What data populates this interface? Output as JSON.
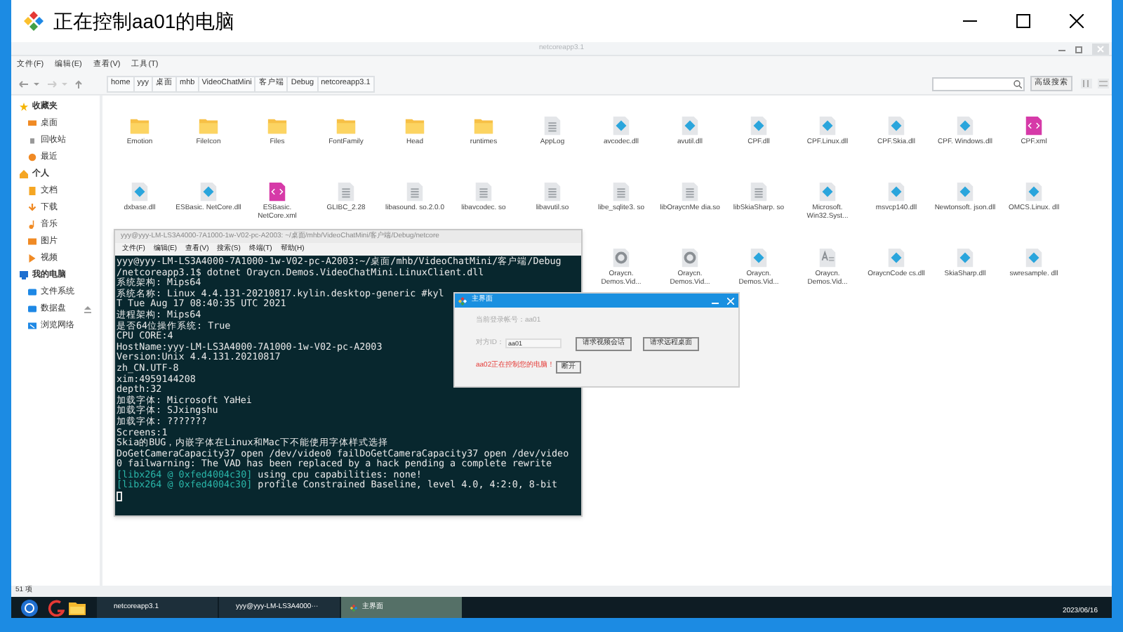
{
  "remote_window": {
    "title": "正在控制aa01的电脑"
  },
  "file_manager": {
    "title": "netcoreapp3.1",
    "menu": [
      "文件(F)",
      "编辑(E)",
      "查看(V)",
      "工具(T)"
    ],
    "breadcrumb": [
      "home",
      "yyy",
      "桌面",
      "mhb",
      "VideoChatMini",
      "客户端",
      "Debug",
      "netcoreapp3.1"
    ],
    "advanced_search_button": "高级搜索",
    "sidebar": [
      {
        "label": "收藏夹",
        "kind": "header"
      },
      {
        "label": "桌面",
        "kind": "item"
      },
      {
        "label": "回收站",
        "kind": "item"
      },
      {
        "label": "最近",
        "kind": "item"
      },
      {
        "label": "个人",
        "kind": "header"
      },
      {
        "label": "文档",
        "kind": "item"
      },
      {
        "label": "下载",
        "kind": "item"
      },
      {
        "label": "音乐",
        "kind": "item"
      },
      {
        "label": "图片",
        "kind": "item"
      },
      {
        "label": "视频",
        "kind": "item"
      },
      {
        "label": "我的电脑",
        "kind": "header"
      },
      {
        "label": "文件系统",
        "kind": "item"
      },
      {
        "label": "数据盘",
        "kind": "item",
        "ejectable": true
      },
      {
        "label": "浏览网络",
        "kind": "item"
      }
    ],
    "file_rows": [
      [
        {
          "name": "Emotion",
          "kind": "folder"
        },
        {
          "name": "FileIcon",
          "kind": "folder"
        },
        {
          "name": "Files",
          "kind": "folder"
        },
        {
          "name": "FontFamily",
          "kind": "folder"
        },
        {
          "name": "Head",
          "kind": "folder"
        },
        {
          "name": "runtimes",
          "kind": "folder"
        },
        {
          "name": "AppLog",
          "kind": "text"
        },
        {
          "name": "avcodec.dll",
          "kind": "dll"
        },
        {
          "name": "avutil.dll",
          "kind": "dll"
        },
        {
          "name": "CPF.dll",
          "kind": "dll"
        },
        {
          "name": "CPF.Linux.dll",
          "kind": "dll"
        },
        {
          "name": "CPF.Skia.dll",
          "kind": "dll"
        },
        {
          "name": "CPF. Windows.dll",
          "kind": "dll"
        },
        {
          "name": "CPF.xml",
          "kind": "xml"
        }
      ],
      [
        {
          "name": "dxbase.dll",
          "kind": "dll"
        },
        {
          "name": "ESBasic. NetCore.dll",
          "kind": "dll"
        },
        {
          "name": "ESBasic. NetCore.xml",
          "kind": "xml"
        },
        {
          "name": "GLIBC_2.28",
          "kind": "text"
        },
        {
          "name": "libasound. so.2.0.0",
          "kind": "text"
        },
        {
          "name": "libavcodec. so",
          "kind": "text"
        },
        {
          "name": "libavutil.so",
          "kind": "text"
        },
        {
          "name": "libe_sqlite3. so",
          "kind": "text"
        },
        {
          "name": "libOraycnMe dia.so",
          "kind": "text"
        },
        {
          "name": "libSkiaSharp. so",
          "kind": "text"
        },
        {
          "name": "Microsoft. Win32.Syst...",
          "kind": "dll"
        },
        {
          "name": "msvcp140.dll",
          "kind": "dll"
        },
        {
          "name": "Newtonsoft. json.dll",
          "kind": "dll"
        },
        {
          "name": "OMCS.Linux. dll",
          "kind": "dll"
        }
      ],
      [
        {
          "name": "Oraycn. Demos.Vid...",
          "kind": "gear"
        },
        {
          "name": "Oraycn. Demos.Vid...",
          "kind": "gear"
        },
        {
          "name": "Oraycn. Demos.Vid...",
          "kind": "dll"
        },
        {
          "name": "Oraycn. Demos.Vid...",
          "kind": "font"
        },
        {
          "name": "OraycnCode cs.dll",
          "kind": "dll"
        },
        {
          "name": "SkiaSharp.dll",
          "kind": "dll"
        },
        {
          "name": "swresample. dll",
          "kind": "dll"
        }
      ]
    ],
    "status": "51 项"
  },
  "terminal": {
    "title": "yyy@yyy-LM-LS3A4000-7A1000-1w-V02-pc-A2003: ~/桌面/mhb/VideoChatMini/客户端/Debug/netcore",
    "menu": [
      "文件(F)",
      "编辑(E)",
      "查看(V)",
      "搜索(S)",
      "终端(T)",
      "帮助(H)"
    ],
    "lines": [
      {
        "text": "yyy@yyy-LM-LS3A4000-7A1000-1w-V02-pc-A2003:~/桌面/mhb/VideoChatMini/客户端/Debug"
      },
      {
        "text": "/netcoreapp3.1$ dotnet Oraycn.Demos.VideoChatMini.LinuxClient.dll"
      },
      {
        "text": "系统架构: Mips64"
      },
      {
        "text": "系统名称: Linux 4.4.131-20210817.kylin.desktop-generic #kyl"
      },
      {
        "text": "T Tue Aug 17 08:40:35 UTC 2021"
      },
      {
        "text": "进程架构: Mips64"
      },
      {
        "text": "是否64位操作系统: True"
      },
      {
        "text": "CPU CORE:4"
      },
      {
        "text": "HostName:yyy-LM-LS3A4000-7A1000-1w-V02-pc-A2003"
      },
      {
        "text": "Version:Unix 4.4.131.20210817"
      },
      {
        "text": "zh_CN.UTF-8"
      },
      {
        "text": "xim:4959144208"
      },
      {
        "text": "depth:32"
      },
      {
        "text": "加载字体: Microsoft YaHei"
      },
      {
        "text": "加载字体: SJxingshu"
      },
      {
        "text": "加载字体: ???????"
      },
      {
        "text": "Screens:1"
      },
      {
        "text": "Skia的BUG，内嵌字体在Linux和Mac下不能使用字体样式选择"
      },
      {
        "text": "DoGetCameraCapacity37 open /dev/video0 failDoGetCameraCapacity37 open /dev/video"
      },
      {
        "text": "0 failwarning: The VAD has been replaced by a hack pending a complete rewrite"
      },
      {
        "prefix": "[libx264 @ 0xfed4004c30]",
        "text": " using cpu capabilities: none!"
      },
      {
        "prefix": "[libx264 @ 0xfed4004c30]",
        "text": " profile Constrained Baseline, level 4.0, 4:2:0, 8-bit"
      }
    ]
  },
  "dialog": {
    "title": "主界面",
    "account": "当前登录帐号：aa01",
    "peer_label": "对方ID：",
    "peer_value": "aa01",
    "buttons": [
      "请求视频会话",
      "请求远程桌面"
    ],
    "warning": "aa02正在控制您的电脑！",
    "disconnect_button": "断开"
  },
  "taskbar": {
    "tasks": [
      {
        "label": "netcoreapp3.1",
        "selected": false,
        "icon": false
      },
      {
        "label": "yyy@yyy-LM-LS3A4000···",
        "selected": false,
        "icon": false
      },
      {
        "label": "主界面",
        "selected": true,
        "icon": true
      }
    ],
    "date": "2023/06/16"
  }
}
